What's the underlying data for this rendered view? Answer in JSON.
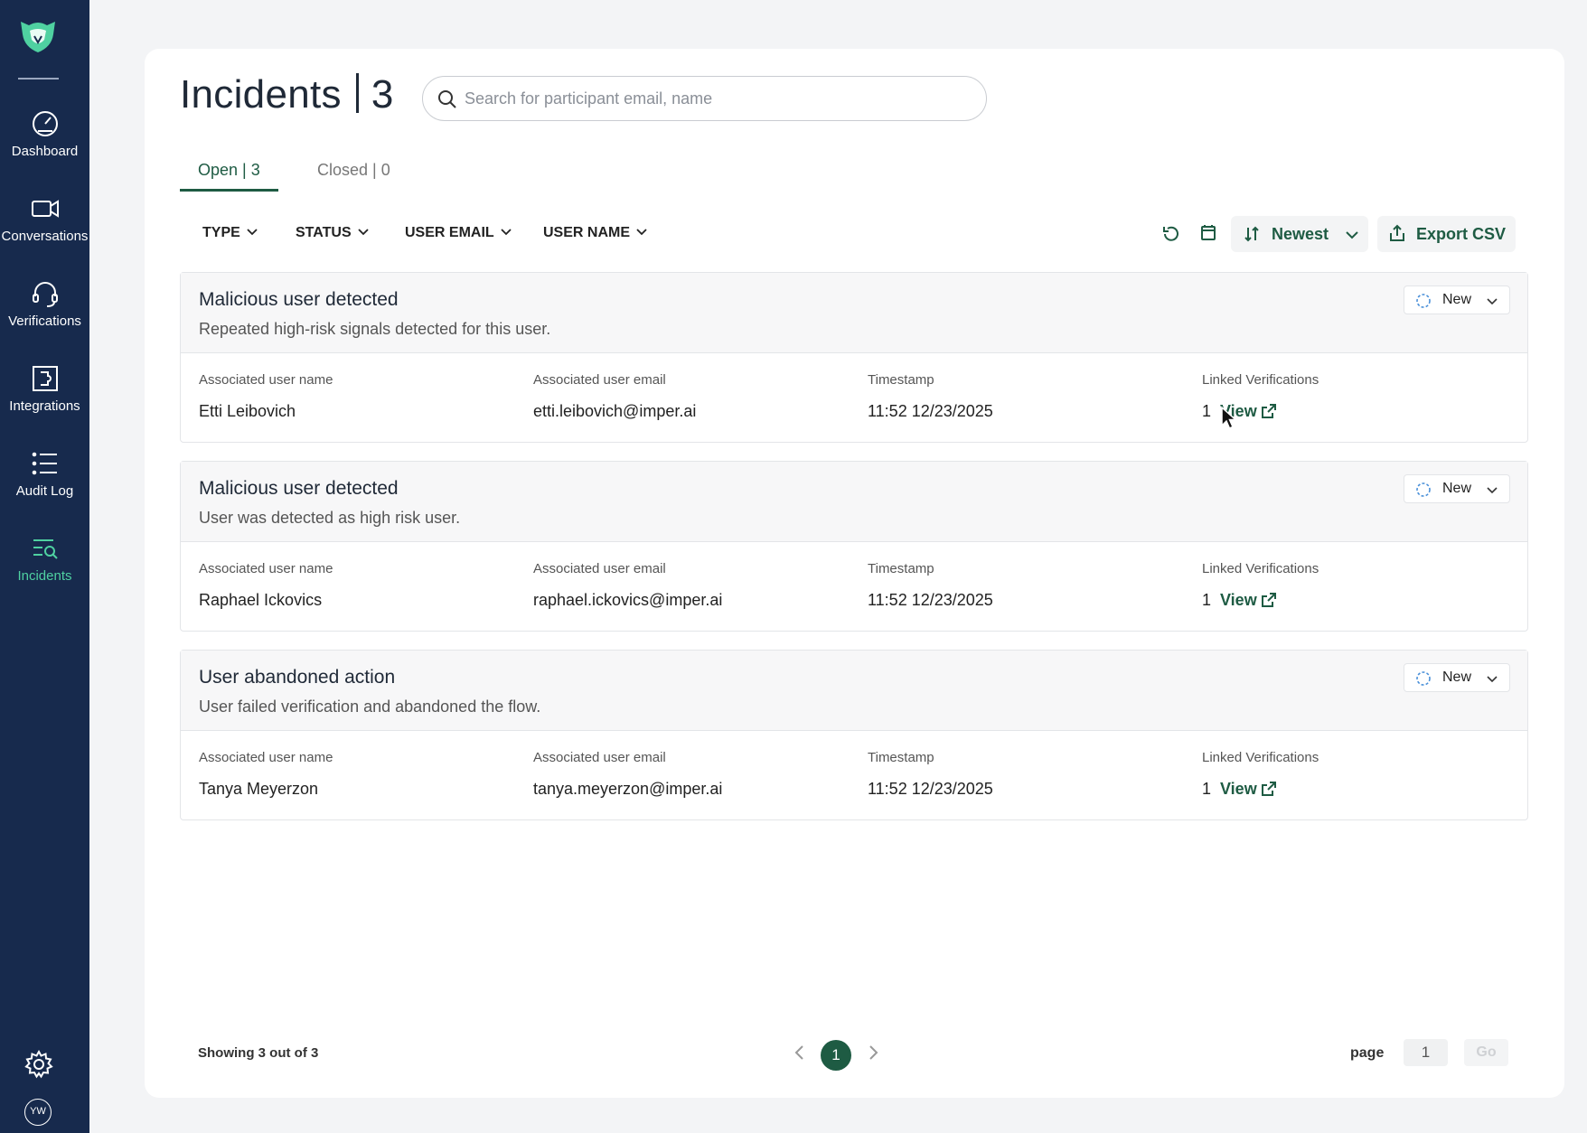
{
  "sidebar": {
    "items": [
      {
        "label": "Dashboard",
        "icon": "speedometer-icon"
      },
      {
        "label": "Conversations",
        "icon": "video-camera-icon"
      },
      {
        "label": "Verifications",
        "icon": "headset-icon"
      },
      {
        "label": "Integrations",
        "icon": "puzzle-icon"
      },
      {
        "label": "Audit Log",
        "icon": "list-icon"
      },
      {
        "label": "Incidents",
        "icon": "incidents-search-icon",
        "active": true
      }
    ],
    "avatar_initials": "YW"
  },
  "header": {
    "title": "Incidents",
    "count": "3",
    "search_placeholder": "Search for participant email, name"
  },
  "tabs": [
    {
      "label": "Open | 3",
      "active": true
    },
    {
      "label": "Closed | 0",
      "active": false
    }
  ],
  "filters": [
    "TYPE",
    "STATUS",
    "USER EMAIL",
    "USER NAME"
  ],
  "toolbar": {
    "sort_label": "Newest",
    "export_label": "Export CSV"
  },
  "columns": {
    "name": "Associated user name",
    "email": "Associated user email",
    "timestamp": "Timestamp",
    "linked": "Linked Verifications"
  },
  "incidents": [
    {
      "title": "Malicious user detected",
      "description": "Repeated high-risk signals detected for this user.",
      "status": "New",
      "user_name": "Etti Leibovich",
      "user_email": "etti.leibovich@imper.ai",
      "timestamp": "11:52 12/23/2025",
      "linked_count": "1",
      "view_label": "View"
    },
    {
      "title": "Malicious user detected",
      "description": "User was detected as high risk user.",
      "status": "New",
      "user_name": "Raphael Ickovics",
      "user_email": "raphael.ickovics@imper.ai",
      "timestamp": "11:52 12/23/2025",
      "linked_count": "1",
      "view_label": "View"
    },
    {
      "title": "User abandoned action",
      "description": "User failed verification and abandoned the flow.",
      "status": "New",
      "user_name": "Tanya Meyerzon",
      "user_email": "tanya.meyerzon@imper.ai",
      "timestamp": "11:52 12/23/2025",
      "linked_count": "1",
      "view_label": "View"
    }
  ],
  "footer": {
    "showing": "Showing 3 out of 3",
    "current_page": "1",
    "page_label": "page",
    "page_input": "1",
    "go_label": "Go"
  },
  "colors": {
    "sidebar_bg": "#172a4d",
    "accent": "#1e5b43",
    "active_nav": "#4fd1a1"
  }
}
